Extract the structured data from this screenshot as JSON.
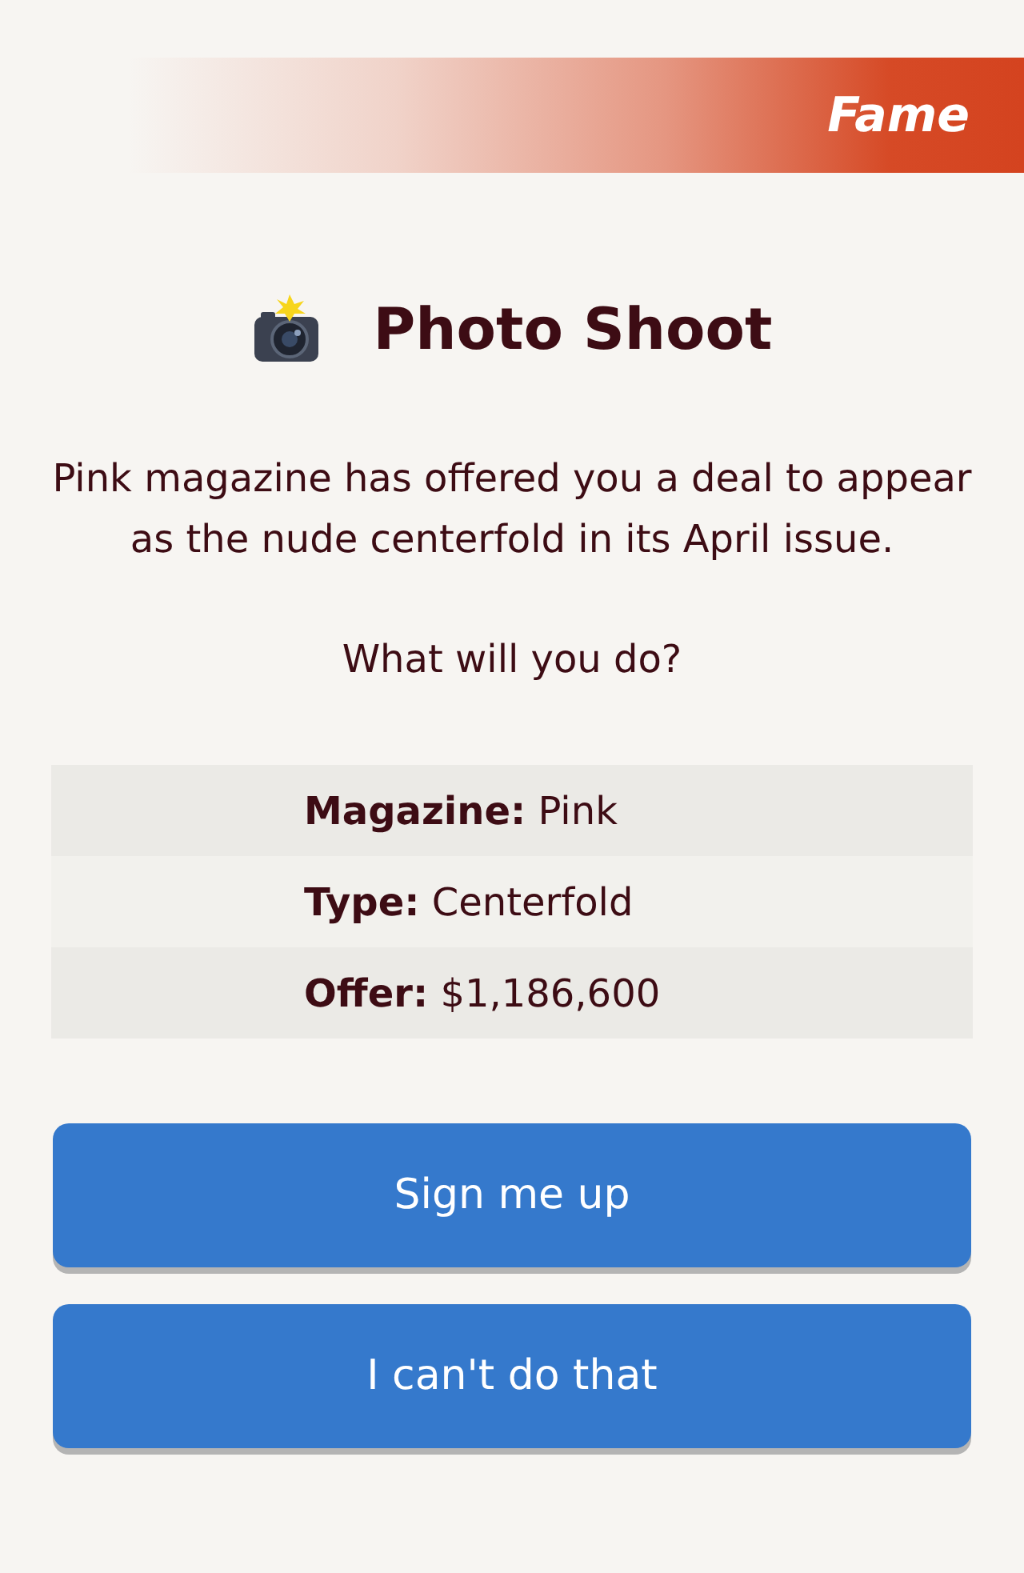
{
  "banner": {
    "label": "Fame"
  },
  "title": "Photo Shoot",
  "message": "Pink magazine has offered you a deal to appear as the nude centerfold in its April issue.",
  "question": "What will you do?",
  "details": [
    {
      "text": "**Magazine:** Pink"
    },
    {
      "text": "**Type:** Centerfold"
    },
    {
      "text": "**Offer:** $1,186,600"
    }
  ],
  "buttons": [
    "Sign me up",
    "I can't do that"
  ]
}
